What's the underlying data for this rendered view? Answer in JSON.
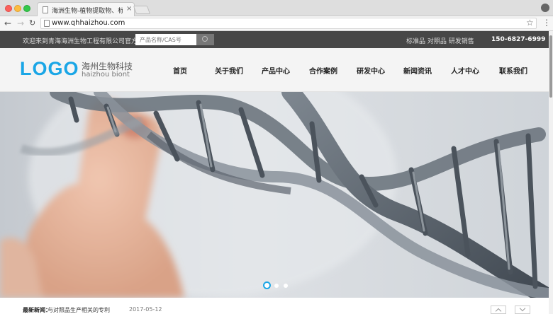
{
  "browser": {
    "tab_title": "海洲生物-植物提取物、标准品",
    "tab_close": "×",
    "url": "www.qhhaizhou.com",
    "back": "←",
    "forward": "→",
    "reload": "↻",
    "star": "☆",
    "menu": "⋮"
  },
  "topbar": {
    "welcome": "欢迎来到青海海洲生物工程有限公司官方网站！",
    "search_placeholder": "产品名称/CAS号",
    "links": "标准品  对照品  研发销售",
    "phone": "150-6827-6999"
  },
  "header": {
    "logo": "LOGO",
    "logo_cn": "海州生物科技",
    "logo_en": "haizhou biont"
  },
  "nav": [
    {
      "label": "首页"
    },
    {
      "label": "关于我们"
    },
    {
      "label": "产品中心"
    },
    {
      "label": "合作案例"
    },
    {
      "label": "研发中心"
    },
    {
      "label": "新闻资讯"
    },
    {
      "label": "人才中心"
    },
    {
      "label": "联系我们"
    }
  ],
  "carousel": {
    "slide_count": 3,
    "active_index": 0
  },
  "news": {
    "label": "最新新闻：",
    "title": "与对照品生产相关的专利",
    "date": "2017-05-12"
  },
  "colors": {
    "accent": "#1aa6e6",
    "topbar_bg": "#474747",
    "header_bg": "#f4f4f4"
  }
}
